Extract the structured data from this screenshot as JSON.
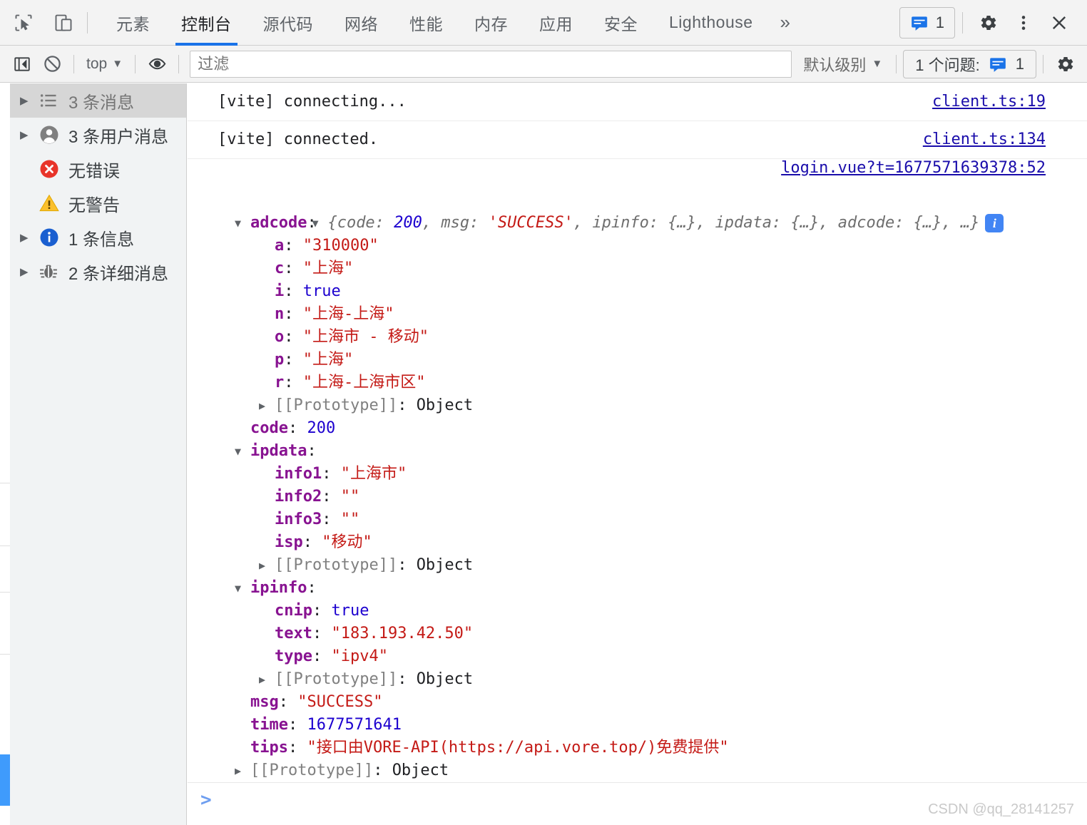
{
  "devtools": {
    "toolbar": {
      "inspect_icon": "inspect-cursor-icon",
      "device_icon": "device-toolbar-icon",
      "tabs": [
        {
          "label": "元素",
          "active": false
        },
        {
          "label": "控制台",
          "active": true
        },
        {
          "label": "源代码",
          "active": false
        },
        {
          "label": "网络",
          "active": false
        },
        {
          "label": "性能",
          "active": false
        },
        {
          "label": "内存",
          "active": false
        },
        {
          "label": "应用",
          "active": false
        },
        {
          "label": "安全",
          "active": false
        },
        {
          "label": "Lighthouse",
          "active": false
        }
      ],
      "more_tabs_label": "»",
      "issues_count": "1",
      "settings_icon": "gear-icon",
      "more_options_icon": "three-dots-vertical-icon",
      "close_icon": "close-x-icon"
    },
    "filterbar": {
      "sidebar_toggle_icon": "show-console-sidebar-icon",
      "clear_icon": "clear-console-icon",
      "context_label": "top",
      "eye_icon": "live-expression-eye-icon",
      "filter_placeholder": "过滤",
      "filter_value": "",
      "level_label": "默认级别",
      "issue_text": "1 个问题:",
      "issue_count": "1",
      "settings_icon": "console-settings-gear-icon"
    },
    "sidebar": {
      "items": [
        {
          "label": "3 条消息",
          "icon": "list-messages-icon",
          "expandable": true,
          "selected": true
        },
        {
          "label": "3 条用户消息",
          "icon": "user-messages-icon",
          "expandable": true,
          "selected": false
        },
        {
          "label": "无错误",
          "icon": "error-circle-icon",
          "expandable": false,
          "selected": false
        },
        {
          "label": "无警告",
          "icon": "warning-triangle-icon",
          "expandable": false,
          "selected": false
        },
        {
          "label": "1 条信息",
          "icon": "info-circle-icon",
          "expandable": true,
          "selected": false
        },
        {
          "label": "2 条详细消息",
          "icon": "verbose-bug-icon",
          "expandable": true,
          "selected": false
        }
      ]
    },
    "console": {
      "entries": [
        {
          "text": "[vite] connecting...",
          "source": "client.ts:19"
        },
        {
          "text": "[vite] connected.",
          "source": "client.ts:134"
        }
      ],
      "object_source": "login.vue?t=1677571639378:52",
      "object_preview": {
        "prefix": "{code: ",
        "code_value": "200",
        "mid1": ", msg: ",
        "msg_value": "'SUCCESS'",
        "suffix": ", ipinfo: {…}, ipdata: {…}, adcode: {…}, …}",
        "badge": "i"
      },
      "tree": [
        {
          "indent": 1,
          "arrow": "▼",
          "key": "adcode",
          "sep": ":",
          "value": "",
          "vtype": "none"
        },
        {
          "indent": 2,
          "arrow": "",
          "key": "a",
          "sep": ": ",
          "value": "\"310000\"",
          "vtype": "string"
        },
        {
          "indent": 2,
          "arrow": "",
          "key": "c",
          "sep": ": ",
          "value": "\"上海\"",
          "vtype": "string"
        },
        {
          "indent": 2,
          "arrow": "",
          "key": "i",
          "sep": ": ",
          "value": "true",
          "vtype": "bool"
        },
        {
          "indent": 2,
          "arrow": "",
          "key": "n",
          "sep": ": ",
          "value": "\"上海-上海\"",
          "vtype": "string"
        },
        {
          "indent": 2,
          "arrow": "",
          "key": "o",
          "sep": ": ",
          "value": "\"上海市 - 移动\"",
          "vtype": "string"
        },
        {
          "indent": 2,
          "arrow": "",
          "key": "p",
          "sep": ": ",
          "value": "\"上海\"",
          "vtype": "string"
        },
        {
          "indent": 2,
          "arrow": "",
          "key": "r",
          "sep": ": ",
          "value": "\"上海-上海市区\"",
          "vtype": "string"
        },
        {
          "indent": 2,
          "arrow": "▶",
          "key": "[[Prototype]]",
          "sep": ": ",
          "value": "Object",
          "vtype": "proto"
        },
        {
          "indent": 1,
          "arrow": "",
          "key": "code",
          "sep": ": ",
          "value": "200",
          "vtype": "number"
        },
        {
          "indent": 1,
          "arrow": "▼",
          "key": "ipdata",
          "sep": ":",
          "value": "",
          "vtype": "none"
        },
        {
          "indent": 2,
          "arrow": "",
          "key": "info1",
          "sep": ": ",
          "value": "\"上海市\"",
          "vtype": "string"
        },
        {
          "indent": 2,
          "arrow": "",
          "key": "info2",
          "sep": ": ",
          "value": "\"\"",
          "vtype": "string"
        },
        {
          "indent": 2,
          "arrow": "",
          "key": "info3",
          "sep": ": ",
          "value": "\"\"",
          "vtype": "string"
        },
        {
          "indent": 2,
          "arrow": "",
          "key": "isp",
          "sep": ": ",
          "value": "\"移动\"",
          "vtype": "string"
        },
        {
          "indent": 2,
          "arrow": "▶",
          "key": "[[Prototype]]",
          "sep": ": ",
          "value": "Object",
          "vtype": "proto"
        },
        {
          "indent": 1,
          "arrow": "▼",
          "key": "ipinfo",
          "sep": ":",
          "value": "",
          "vtype": "none"
        },
        {
          "indent": 2,
          "arrow": "",
          "key": "cnip",
          "sep": ": ",
          "value": "true",
          "vtype": "bool"
        },
        {
          "indent": 2,
          "arrow": "",
          "key": "text",
          "sep": ": ",
          "value": "\"183.193.42.50\"",
          "vtype": "string"
        },
        {
          "indent": 2,
          "arrow": "",
          "key": "type",
          "sep": ": ",
          "value": "\"ipv4\"",
          "vtype": "string"
        },
        {
          "indent": 2,
          "arrow": "▶",
          "key": "[[Prototype]]",
          "sep": ": ",
          "value": "Object",
          "vtype": "proto"
        },
        {
          "indent": 1,
          "arrow": "",
          "key": "msg",
          "sep": ": ",
          "value": "\"SUCCESS\"",
          "vtype": "string"
        },
        {
          "indent": 1,
          "arrow": "",
          "key": "time",
          "sep": ": ",
          "value": "1677571641",
          "vtype": "number"
        },
        {
          "indent": 1,
          "arrow": "",
          "key": "tips",
          "sep": ": ",
          "value": "\"接口由VORE-API(https://api.vore.top/)免费提供\"",
          "vtype": "string"
        },
        {
          "indent": 1,
          "arrow": "▶",
          "key": "[[Prototype]]",
          "sep": ": ",
          "value": "Object",
          "vtype": "proto"
        }
      ],
      "prompt_chevron": ">",
      "prompt_value": ""
    },
    "watermark": "CSDN @qq_28141257"
  }
}
